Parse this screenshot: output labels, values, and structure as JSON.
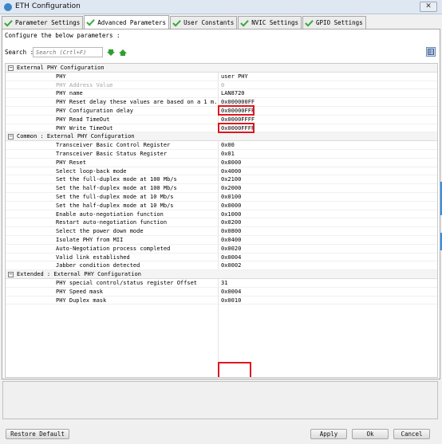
{
  "window": {
    "title": "ETH Configuration",
    "close_label": "✕"
  },
  "tabs": [
    {
      "label": "Parameter Settings",
      "active": false
    },
    {
      "label": "Advanced Parameters",
      "active": true
    },
    {
      "label": "User Constants",
      "active": false
    },
    {
      "label": "NVIC Settings",
      "active": false
    },
    {
      "label": "GPIO Settings",
      "active": false
    }
  ],
  "panel": {
    "instruction": "Configure the below parameters :",
    "search_label": "Search :",
    "search_placeholder": "Search (Crtl+F)"
  },
  "groups": [
    {
      "title": "External PHY Configuration",
      "toggle": "−",
      "params": [
        {
          "name": "PHY",
          "value": "user PHY",
          "disabled": false,
          "highlight": true
        },
        {
          "name": "PHY Address Value",
          "value": "0",
          "disabled": true
        },
        {
          "name": "PHY name",
          "value": "LAN8720",
          "disabled": false,
          "highlight": true
        },
        {
          "name": "PHY Reset delay these values are based on a 1 m...",
          "value": "0x000000FF",
          "disabled": false
        },
        {
          "name": "PHY Configuration delay",
          "value": "0x00000FFF",
          "disabled": false
        },
        {
          "name": "PHY Read TimeOut",
          "value": "0x0000FFFF",
          "disabled": false
        },
        {
          "name": "PHY Write TimeOut",
          "value": "0x0000FFFF",
          "disabled": false
        }
      ]
    },
    {
      "title": "Common : External PHY Configuration",
      "toggle": "−",
      "params": [
        {
          "name": "Transceiver Basic Control Register",
          "value": "0x00",
          "disabled": false
        },
        {
          "name": "Transceiver Basic Status Register",
          "value": "0x01",
          "disabled": false
        },
        {
          "name": "PHY Reset",
          "value": "0x8000",
          "disabled": false
        },
        {
          "name": "Select loop-back mode",
          "value": "0x4000",
          "disabled": false
        },
        {
          "name": "Set the full-duplex mode at 100 Mb/s",
          "value": "0x2100",
          "disabled": false
        },
        {
          "name": "Set the half-duplex mode at 100 Mb/s",
          "value": "0x2000",
          "disabled": false
        },
        {
          "name": "Set the full-duplex mode at 10 Mb/s",
          "value": "0x0100",
          "disabled": false
        },
        {
          "name": "Set the half-duplex mode at 10 Mb/s",
          "value": "0x0000",
          "disabled": false
        },
        {
          "name": "Enable auto-negotiation function",
          "value": "0x1000",
          "disabled": false
        },
        {
          "name": "Restart auto-negotiation function",
          "value": "0x0200",
          "disabled": false
        },
        {
          "name": "Select the power down mode",
          "value": "0x0800",
          "disabled": false
        },
        {
          "name": "Isolate PHY from MII",
          "value": "0x0400",
          "disabled": false
        },
        {
          "name": "Auto-Negotiation process completed",
          "value": "0x0020",
          "disabled": false
        },
        {
          "name": "Valid link established",
          "value": "0x0004",
          "disabled": false
        },
        {
          "name": "Jabber condition detected",
          "value": "0x0002",
          "disabled": false
        }
      ]
    },
    {
      "title": "Extended : External PHY Configuration",
      "toggle": "−",
      "params": [
        {
          "name": "PHY special control/status register Offset",
          "value": "31",
          "disabled": false
        },
        {
          "name": "PHY Speed mask",
          "value": "0x0004",
          "disabled": false
        },
        {
          "name": "PHY Duplex mask",
          "value": "0x0010",
          "disabled": false
        }
      ]
    }
  ],
  "buttons": {
    "restore": "Restore Default",
    "apply": "Apply",
    "ok": "Ok",
    "cancel": "Cancel"
  },
  "colors": {
    "highlight": "#e0161e",
    "check_green": "#3aa83a",
    "arrow_green": "#2e9e2e",
    "accent_blue": "#3b8fe0"
  },
  "icons": {
    "tab_check": "check-icon",
    "expand_all": "arrow-down-icon",
    "collapse_all": "arrow-up-icon",
    "categorized_view": "grid-view-icon"
  }
}
